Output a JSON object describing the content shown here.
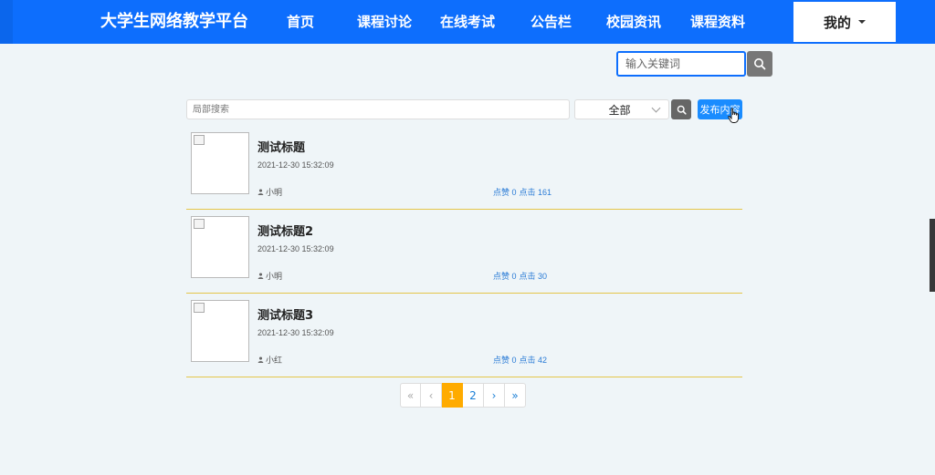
{
  "nav": {
    "brand": "大学生网络教学平台",
    "items": [
      "首页",
      "课程讨论",
      "在线考试",
      "公告栏",
      "校园资讯",
      "课程资料"
    ],
    "mine": "我的"
  },
  "header_search": {
    "placeholder": "输入关键词"
  },
  "filter": {
    "placeholder": "局部搜索",
    "select_value": "全部",
    "publish_label": "发布内容"
  },
  "posts": [
    {
      "title": "测试标题",
      "time": "2021-12-30 15:32:09",
      "author": "小明",
      "likes_label": "点赞 0",
      "clicks_label": "点击 161"
    },
    {
      "title": "测试标题2",
      "time": "2021-12-30 15:32:09",
      "author": "小明",
      "likes_label": "点赞 0",
      "clicks_label": "点击 30"
    },
    {
      "title": "测试标题3",
      "time": "2021-12-30 15:32:09",
      "author": "小红",
      "likes_label": "点赞 0",
      "clicks_label": "点击 42"
    }
  ],
  "pagination": {
    "first": "«",
    "prev": "‹",
    "pages": [
      "1",
      "2"
    ],
    "current": "1",
    "next": "›",
    "last": "»"
  },
  "colors": {
    "nav": "#0d6efd",
    "accent": "#1a8cff",
    "active_page": "#ffab00",
    "divider": "#e5c64a"
  },
  "icons": {
    "search": "search-icon",
    "user": "user-icon",
    "caret": "caret-down-icon"
  }
}
